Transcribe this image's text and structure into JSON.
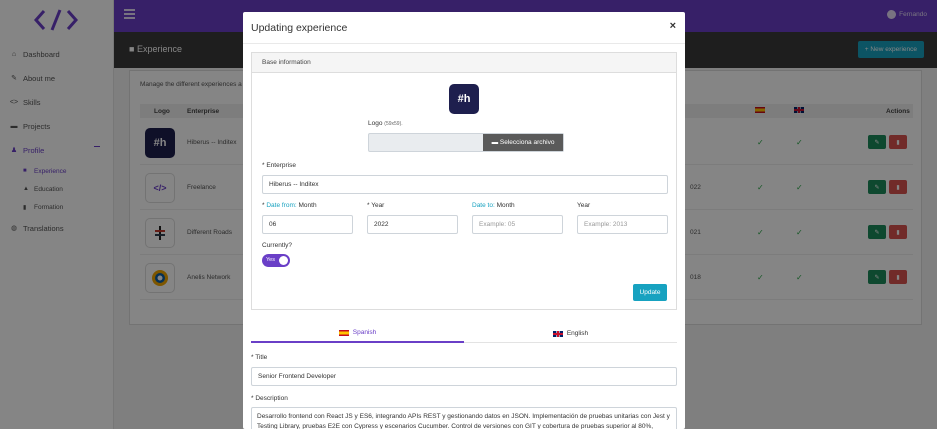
{
  "topbar": {
    "user_name": "Fernando"
  },
  "sidebar": {
    "items": [
      {
        "label": "Dashboard",
        "icon": "home-icon"
      },
      {
        "label": "About me",
        "icon": "user-pen-icon"
      },
      {
        "label": "Skills",
        "icon": "code-icon"
      },
      {
        "label": "Projects",
        "icon": "folder-icon"
      },
      {
        "label": "Profile",
        "icon": "profile-icon"
      },
      {
        "label": "Translations",
        "icon": "globe-icon"
      }
    ],
    "profile_sub": [
      {
        "label": "Experience",
        "icon": "briefcase-icon"
      },
      {
        "label": "Education",
        "icon": "graduation-cap-icon"
      },
      {
        "label": "Formation",
        "icon": "book-icon"
      }
    ]
  },
  "page": {
    "title": "Experience",
    "new_button": "+ New experience",
    "description": "Manage the different experiences a"
  },
  "table": {
    "headers": {
      "logo": "Logo",
      "enterprise": "Enterprise",
      "actions": "Actions"
    },
    "rows": [
      {
        "logo_text": "#h",
        "enterprise": "Hiberus -- Inditex",
        "year": ""
      },
      {
        "logo_text": "</>",
        "enterprise": "Freelance",
        "year": "022"
      },
      {
        "logo_text": "",
        "enterprise": "Different Roads",
        "year": "021"
      },
      {
        "logo_text": "",
        "enterprise": "Anelis Network",
        "year": "018"
      }
    ]
  },
  "modal": {
    "title": "Updating experience",
    "close": "×",
    "base_info": "Base information",
    "logo_preview": "#h",
    "logo_label": "Logo",
    "logo_hint": "(59x59).",
    "file_button": "Selecciona archivo",
    "enterprise_label": "* Enterprise",
    "enterprise_value": "Hiberus -- Inditex",
    "date_from_prefix": "* ",
    "date_from": "Date from:",
    "date_from_suffix": " Month",
    "date_from_month": "06",
    "year_label": "* Year",
    "year_value": "2022",
    "date_to": "Date to:",
    "date_to_suffix": " Month",
    "date_to_placeholder": "Example: 05",
    "year_to_label": "Year",
    "year_to_placeholder": "Example: 2013",
    "currently_label": "Currently?",
    "toggle_label": "Yes",
    "update_button": "Update",
    "tab_spanish": "Spanish",
    "tab_english": "English",
    "title_label": "* Title",
    "title_value": "Senior Frontend Developer",
    "description_label": "* Description",
    "description_value": "Desarrollo frontend con React JS y ES6, integrando APIs REST y gestionando datos en JSON. Implementación de pruebas unitarias con Jest y Testing Library, pruebas E2E con Cypress y escenarios Cucumber. Control de versiones con GIT y cobertura de pruebas superior al 80%,"
  },
  "colors": {
    "primary": "#6a3fc7",
    "info": "#17a2c0",
    "success": "#1c8a5a",
    "danger": "#d9534f"
  }
}
